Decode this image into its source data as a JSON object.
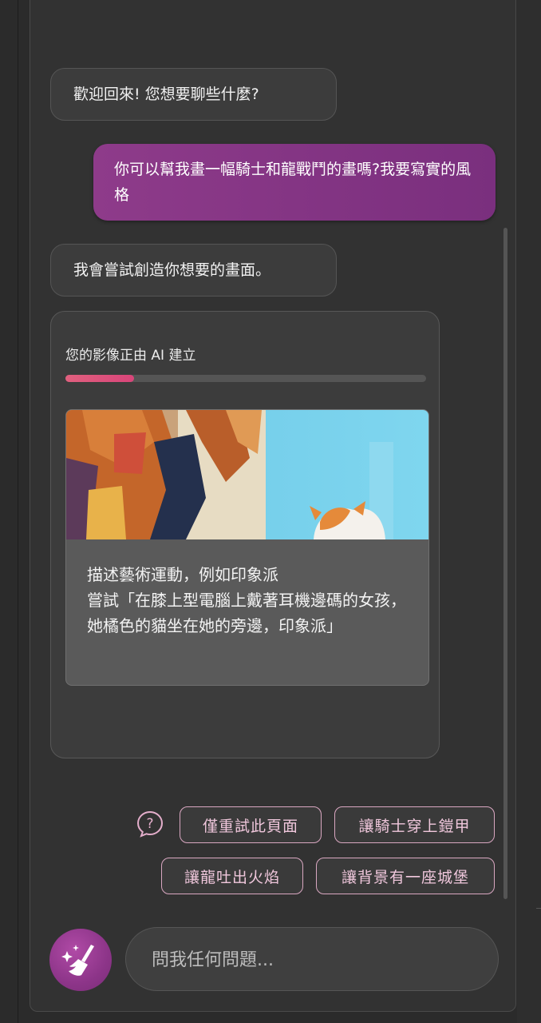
{
  "chat": {
    "welcome": "歡迎回來! 您想要聊些什麼?",
    "user_message": "你可以幫我畫一幅騎士和龍戰鬥的畫嗎?我要寫實的風格",
    "bot_reply": "我會嘗試創造你想要的畫面。"
  },
  "image_card": {
    "status": "您的影像正由 AI 建立",
    "progress": 0.19,
    "tip_line1": "描述藝術運動，例如印象派",
    "tip_line2": "嘗試「在膝上型電腦上戴著耳機邊碼的女孩，她橘色的貓坐在她的旁邊，印象派」"
  },
  "suggestions": {
    "help_icon": "question-bubble-icon",
    "chips": [
      "僅重試此頁面",
      "讓騎士穿上鎧甲",
      "讓龍吐出火焰",
      "讓背景有一座城堡"
    ]
  },
  "composer": {
    "clear_icon": "broom-sparkle-icon",
    "placeholder": "問我任何問題..."
  },
  "colors": {
    "accent": "#8e3b8a",
    "chip_border": "#d9a7c1",
    "progress": "#e0607e",
    "background": "#323232"
  }
}
